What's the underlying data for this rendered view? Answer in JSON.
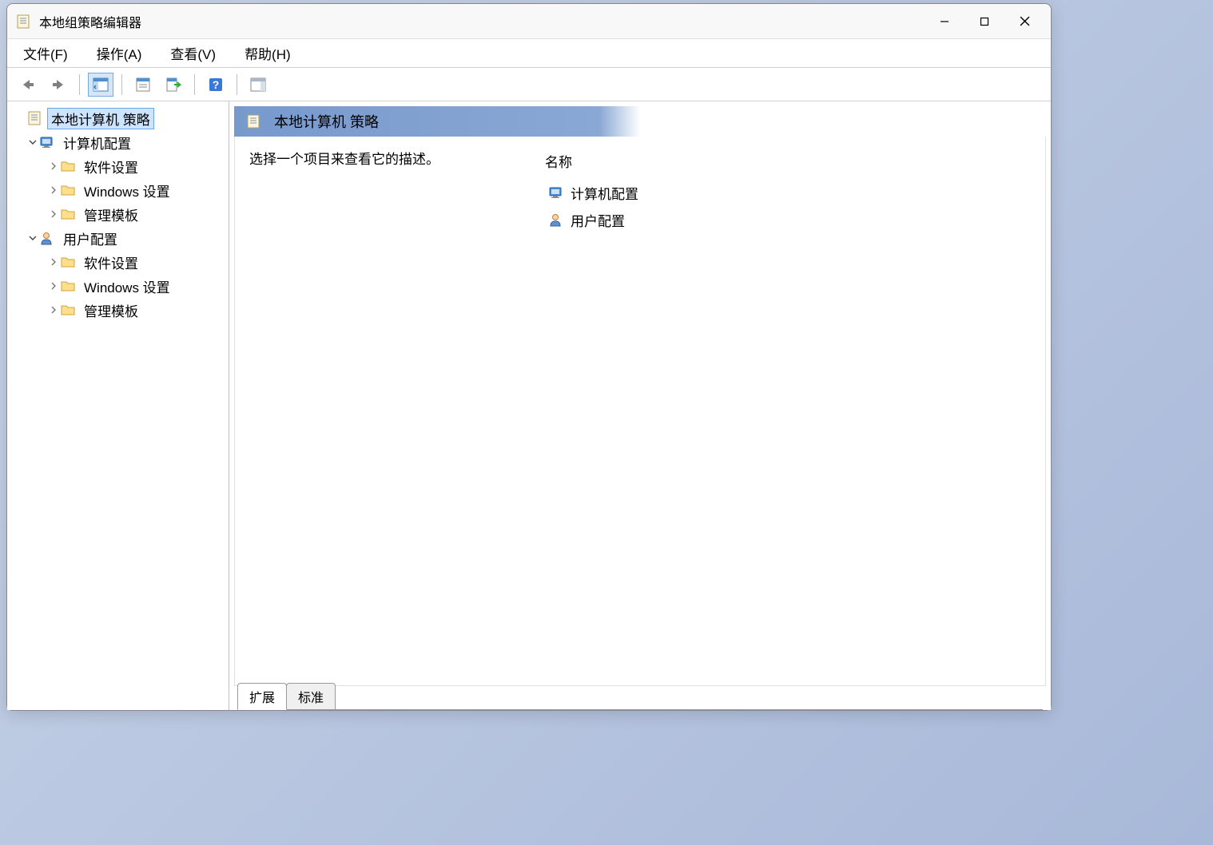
{
  "window": {
    "title": "本地组策略编辑器"
  },
  "menubar": {
    "file": "文件(F)",
    "action": "操作(A)",
    "view": "查看(V)",
    "help": "帮助(H)"
  },
  "toolbar": {
    "back": "back-icon",
    "forward": "forward-icon",
    "up": "up-pane-icon",
    "properties": "properties-icon",
    "export": "export-list-icon",
    "help": "help-icon",
    "show_hide": "show-hide-icon"
  },
  "tree": {
    "root": "本地计算机 策略",
    "computer_config": "计算机配置",
    "software_settings": "软件设置",
    "windows_settings": "Windows 设置",
    "admin_templates": "管理模板",
    "user_config": "用户配置"
  },
  "detail": {
    "header": "本地计算机 策略",
    "description_prompt": "选择一个项目来查看它的描述。",
    "column_name": "名称",
    "items": {
      "computer_config": "计算机配置",
      "user_config": "用户配置"
    },
    "tabs": {
      "extended": "扩展",
      "standard": "标准"
    }
  }
}
